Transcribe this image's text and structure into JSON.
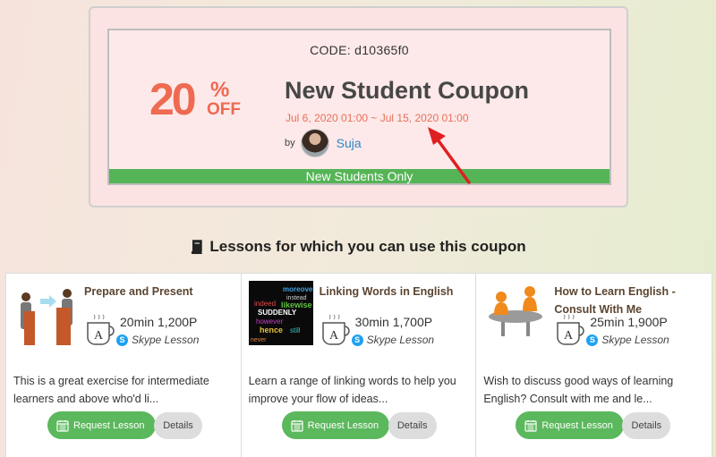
{
  "coupon": {
    "code": "CODE: d10365f0",
    "discount_number": "20",
    "discount_percent": "%",
    "discount_off": "OFF",
    "title": "New Student Coupon",
    "dates": "Jul 6, 2020 01:00 ~ Jul 15, 2020 01:00",
    "by_label": "by",
    "teacher_name": "Suja",
    "eligibility": "New Students Only",
    "accent_color": "#ee6a51",
    "bar_color": "#55b456"
  },
  "section": {
    "heading": "Lessons for which you can use this coupon",
    "icon": "book-icon"
  },
  "lessons": [
    {
      "title": "Prepare and Present",
      "duration_price": "20min 1,200P",
      "lesson_type": "Skype Lesson",
      "description": "This is a great exercise for intermediate learners and above who'd li...",
      "request_label": "Request Lesson",
      "details_label": "Details",
      "thumbnail": "presentation-illustration"
    },
    {
      "title": "Linking Words in English",
      "duration_price": "30min 1,700P",
      "lesson_type": "Skype Lesson",
      "description": "Learn a range of linking words to help you improve your flow of ideas...",
      "request_label": "Request Lesson",
      "details_label": "Details",
      "thumbnail": "word-cloud-image",
      "thumb_words": [
        "moreover",
        "instead",
        "likewise",
        "indeed",
        "SUDDENLY",
        "however",
        "hence",
        "still",
        "never"
      ]
    },
    {
      "title": "How to Learn English - Consult With Me",
      "duration_price": "25min 1,900P",
      "lesson_type": "Skype Lesson",
      "description": "Wish to discuss good ways of learning English? Consult with me and le...",
      "request_label": "Request Lesson",
      "details_label": "Details",
      "thumbnail": "consultation-illustration"
    }
  ]
}
